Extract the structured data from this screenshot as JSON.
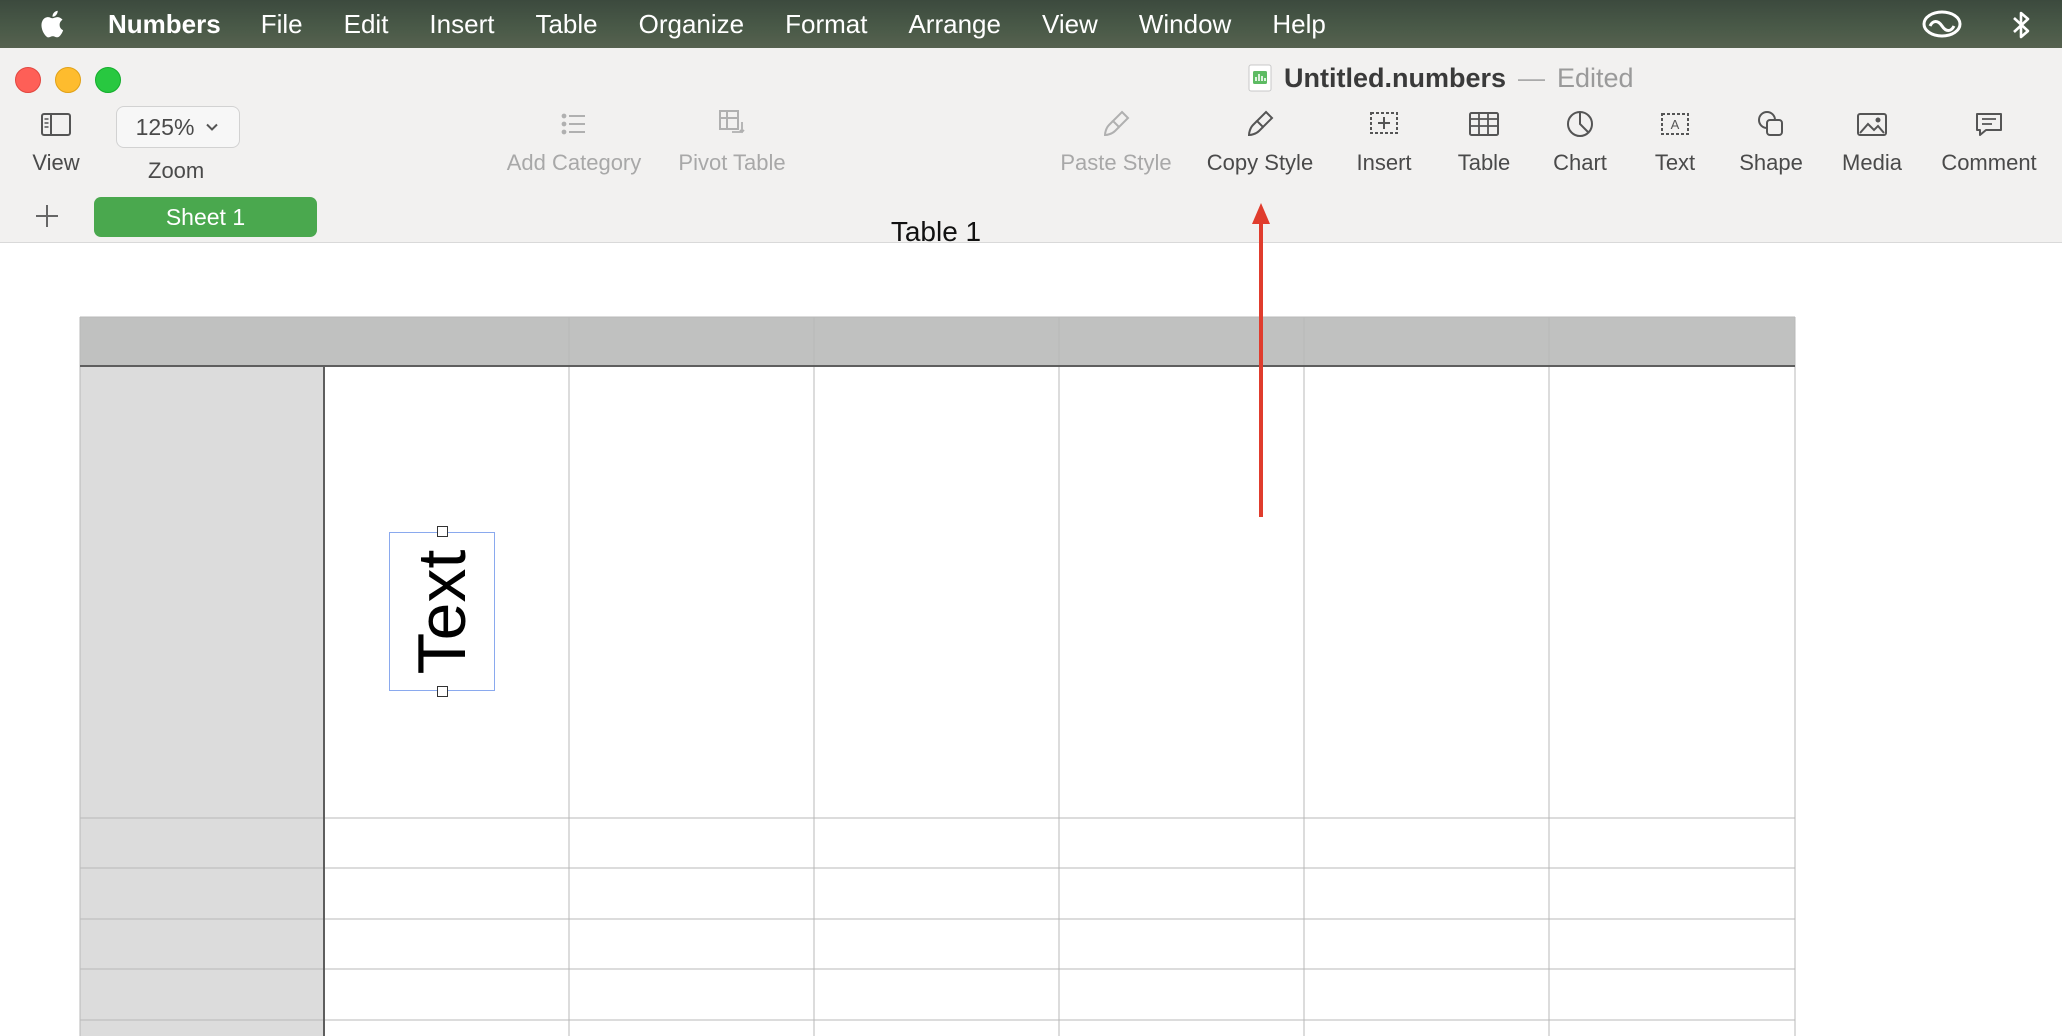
{
  "menubar": {
    "app_name": "Numbers",
    "items": [
      "File",
      "Edit",
      "Insert",
      "Table",
      "Organize",
      "Format",
      "Arrange",
      "View",
      "Window",
      "Help"
    ],
    "status_icons": [
      "creative-cloud-icon",
      "bluetooth-icon"
    ]
  },
  "window": {
    "title": "Untitled.numbers",
    "separator": "—",
    "status": "Edited"
  },
  "toolbar": {
    "view_label": "View",
    "zoom_value": "125%",
    "zoom_label": "Zoom",
    "add_category_label": "Add Category",
    "pivot_table_label": "Pivot Table",
    "paste_style_label": "Paste Style",
    "copy_style_label": "Copy Style",
    "insert_label": "Insert",
    "table_label": "Table",
    "chart_label": "Chart",
    "text_label": "Text",
    "shape_label": "Shape",
    "media_label": "Media",
    "comment_label": "Comment"
  },
  "sheets": {
    "tabs": [
      "Sheet 1"
    ],
    "active": "Sheet 1"
  },
  "table": {
    "title": "Table 1",
    "columns": 7,
    "header_rows": 1,
    "body_rows": 5
  },
  "textbox": {
    "text": "Text",
    "rotation": "-90deg"
  },
  "colors": {
    "sheet_tab": "#4aa84e",
    "arrow": "#e03c2d",
    "header_fill": "#c0c1c0",
    "header_column_fill": "#dcdcdc",
    "selection_border": "#8aa9ee"
  }
}
